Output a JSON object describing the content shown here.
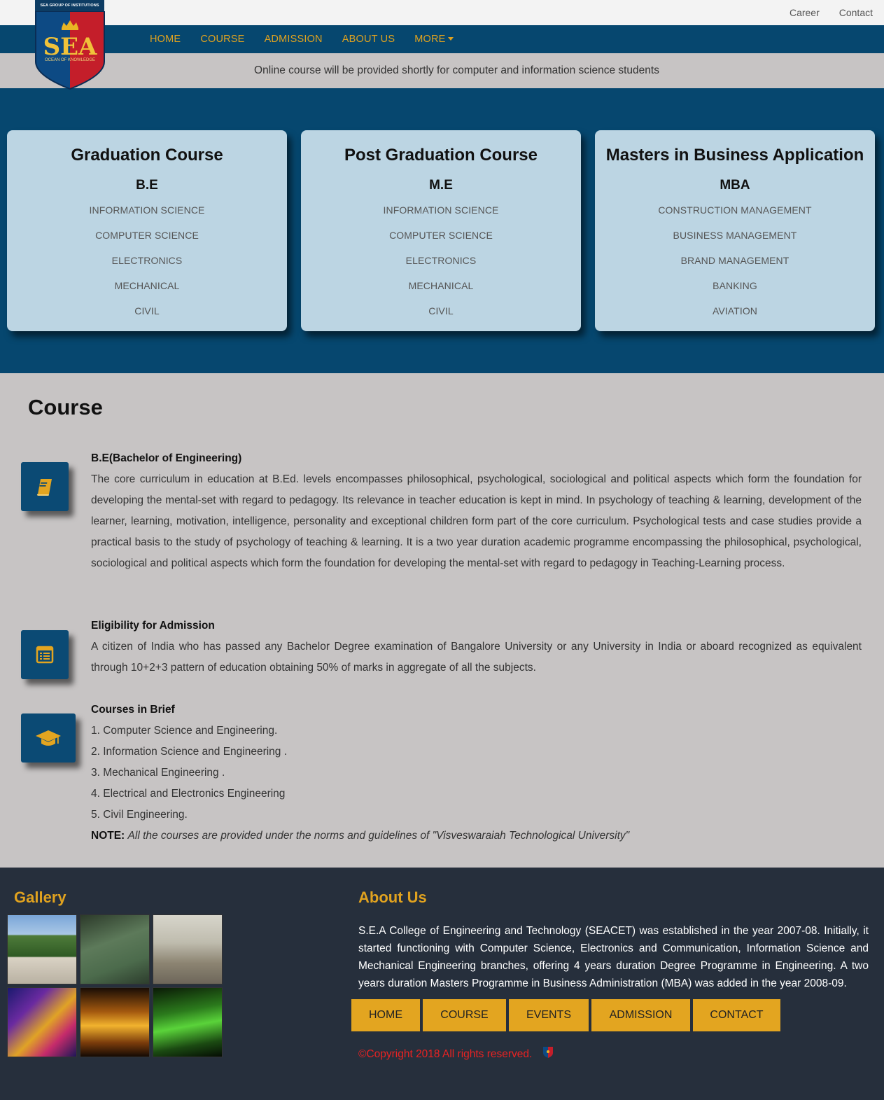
{
  "topbar": {
    "career": "Career",
    "contact": "Contact"
  },
  "logo": {
    "group": "SEA GROUP OF INSTITUTIONS",
    "name": "SEA",
    "tagline": "OCEAN OF KNOWLEDGE"
  },
  "nav": {
    "home": "HOME",
    "course": "COURSE",
    "admission": "ADMISSION",
    "about": "ABOUT US",
    "more": "MORE"
  },
  "notice": "Online course will be provided shortly for computer and information science students",
  "cards": [
    {
      "title": "Graduation Course",
      "degree": "B.E",
      "items": [
        "INFORMATION SCIENCE",
        "COMPUTER SCIENCE",
        "ELECTRONICS",
        "MECHANICAL",
        "CIVIL"
      ]
    },
    {
      "title": "Post Graduation Course",
      "degree": "M.E",
      "items": [
        "INFORMATION SCIENCE",
        "COMPUTER SCIENCE",
        "ELECTRONICS",
        "MECHANICAL",
        "CIVIL"
      ]
    },
    {
      "title": "Masters in Business Application",
      "degree": "MBA",
      "items": [
        "CONSTRUCTION MANAGEMENT",
        "BUSINESS MANAGEMENT",
        "BRAND MANAGEMENT",
        "BANKING",
        "AVIATION"
      ]
    }
  ],
  "course": {
    "heading": "Course",
    "be_title": "B.E(Bachelor of Engineering)",
    "be_text": "The core curriculum in education at B.Ed. levels encompasses philosophical, psychological, sociological and political aspects which form the foundation for developing the mental-set with regard to pedagogy. Its relevance in teacher education is kept in mind. In psychology of teaching & learning, development of the learner, learning, motivation, intelligence, personality and exceptional children form part of the core curriculum. Psychological tests and case studies provide a practical basis to the study of psychology of teaching & learning. It is a two year duration academic programme encompassing the philosophical, psychological, sociological and political aspects which form the foundation for developing the mental-set with regard to pedagogy in Teaching-Learning process.",
    "elig_title": "Eligibility for Admission",
    "elig_text": "A citizen of India who has passed any Bachelor Degree examination of Bangalore University or any University in India or aboard recognized as equivalent through 10+2+3 pattern of education obtaining 50% of marks in aggregate of all the subjects.",
    "brief_title": "Courses in Brief",
    "brief_items": [
      "1. Computer Science and Engineering.",
      "2. Information Science and Engineering .",
      "3. Mechanical Engineering .",
      "4. Electrical and Electronics Engineering",
      "5. Civil Engineering."
    ],
    "note_label": "NOTE:",
    "note_text": "All the courses are provided under the norms and guidelines of \"Visveswaraiah Technological University\""
  },
  "icons": {
    "book": "book-icon",
    "form": "form-icon",
    "cap": "graduation-cap-icon"
  },
  "footer": {
    "gallery_title": "Gallery",
    "about_title": "About Us",
    "about_text": "S.E.A College of Engineering and Technology (SEACET) was established in the year 2007-08. Initially, it started functioning with Computer Science, Electronics and Communication, Information Science and Mechanical Engineering branches, offering 4 years duration Degree Programme in Engineering. A two years duration Masters Programme in Business Administration (MBA) was added in the year 2008-09.",
    "buttons": [
      "HOME",
      "COURSE",
      "EVENTS",
      "ADMISSION",
      "CONTACT"
    ],
    "copyright": "©Copyright 2018 All rights reserved."
  },
  "colors": {
    "navy": "#06476f",
    "gold": "#e0a21f",
    "card": "#bcd5e3",
    "gray": "#c7c4c4",
    "footer": "#262f3c",
    "red": "#ea2222"
  }
}
